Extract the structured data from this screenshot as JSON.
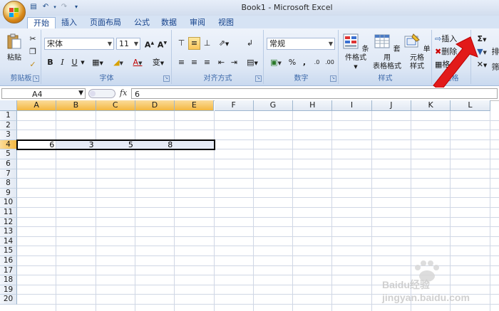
{
  "window": {
    "title": "Book1 - Microsoft Excel"
  },
  "tabs": [
    "开始",
    "插入",
    "页面布局",
    "公式",
    "数据",
    "审阅",
    "视图"
  ],
  "ribbon": {
    "clipboard": {
      "label": "剪贴板",
      "paste": "粘贴"
    },
    "font": {
      "label": "字体",
      "font_name": "宋体",
      "font_size": "11"
    },
    "alignment": {
      "label": "对齐方式"
    },
    "number": {
      "label": "数字",
      "format": "常规"
    },
    "styles": {
      "label": "样式",
      "conditional": "条件格式",
      "table_line1": "套用",
      "table_line2": "表格格式",
      "cell_line1": "单元格",
      "cell_line2": "样式"
    },
    "cells": {
      "label": "单元格",
      "label_visible": "元格",
      "insert": "插入",
      "delete": "删除",
      "format": "格"
    },
    "editing": {
      "sigma": "Σ",
      "sort_line1": "排",
      "sort_line2": "筛"
    }
  },
  "formula_bar": {
    "name_box": "A4",
    "fx": "fx",
    "value": "6"
  },
  "sheet": {
    "columns": [
      "A",
      "B",
      "C",
      "D",
      "E",
      "F",
      "G",
      "H",
      "I",
      "J",
      "K",
      "L"
    ],
    "rows": [
      "1",
      "2",
      "3",
      "4",
      "5",
      "6",
      "7",
      "8",
      "9",
      "10",
      "11",
      "12",
      "13",
      "14",
      "15",
      "16",
      "17",
      "18",
      "19",
      "20"
    ],
    "selected_row": "4",
    "cells_row4": [
      "6",
      "3",
      "5",
      "8"
    ]
  },
  "watermark": "Baidu经验 jingyan.baidu.com",
  "colors": {
    "accent": "#15428b",
    "arrow": "#e21a1a",
    "selection": "#f4b73f"
  }
}
